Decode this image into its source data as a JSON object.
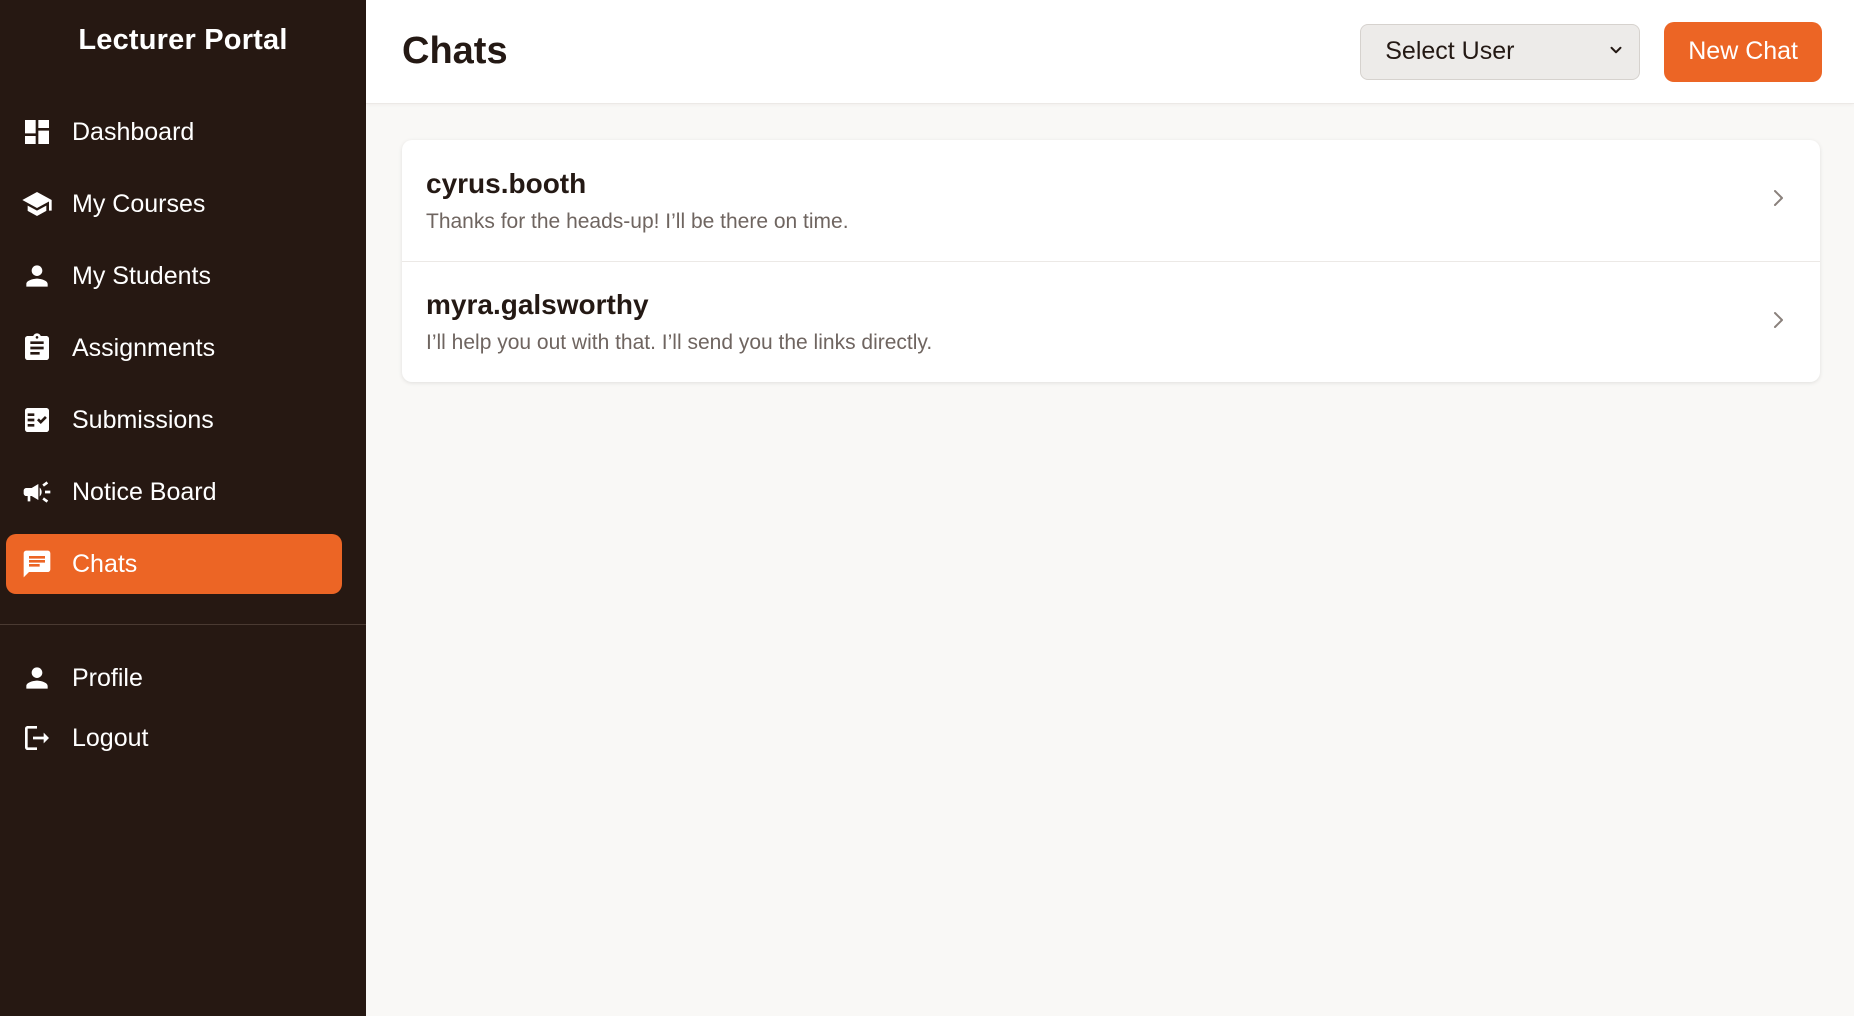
{
  "sidebar": {
    "brand": "Lecturer Portal",
    "items": [
      {
        "label": "Dashboard",
        "icon": "dashboard-icon"
      },
      {
        "label": "My Courses",
        "icon": "graduation-cap-icon"
      },
      {
        "label": "My Students",
        "icon": "person-icon"
      },
      {
        "label": "Assignments",
        "icon": "clipboard-icon"
      },
      {
        "label": "Submissions",
        "icon": "checklist-icon"
      },
      {
        "label": "Notice Board",
        "icon": "megaphone-icon"
      },
      {
        "label": "Chats",
        "icon": "chat-icon",
        "active": true
      }
    ],
    "bottom_items": [
      {
        "label": "Profile",
        "icon": "person-icon"
      },
      {
        "label": "Logout",
        "icon": "logout-icon"
      }
    ]
  },
  "header": {
    "title": "Chats",
    "select_user": "Select User",
    "new_chat": "New Chat"
  },
  "chats": [
    {
      "name": "cyrus.booth",
      "preview": "Thanks for the heads-up! I’ll be there on time."
    },
    {
      "name": "myra.galsworthy",
      "preview": "I’ll help you out with that. I’ll send you the links directly."
    }
  ],
  "colors": {
    "sidebar_bg": "#261812",
    "accent": "#ec6525",
    "page_bg": "#f9f8f6"
  }
}
